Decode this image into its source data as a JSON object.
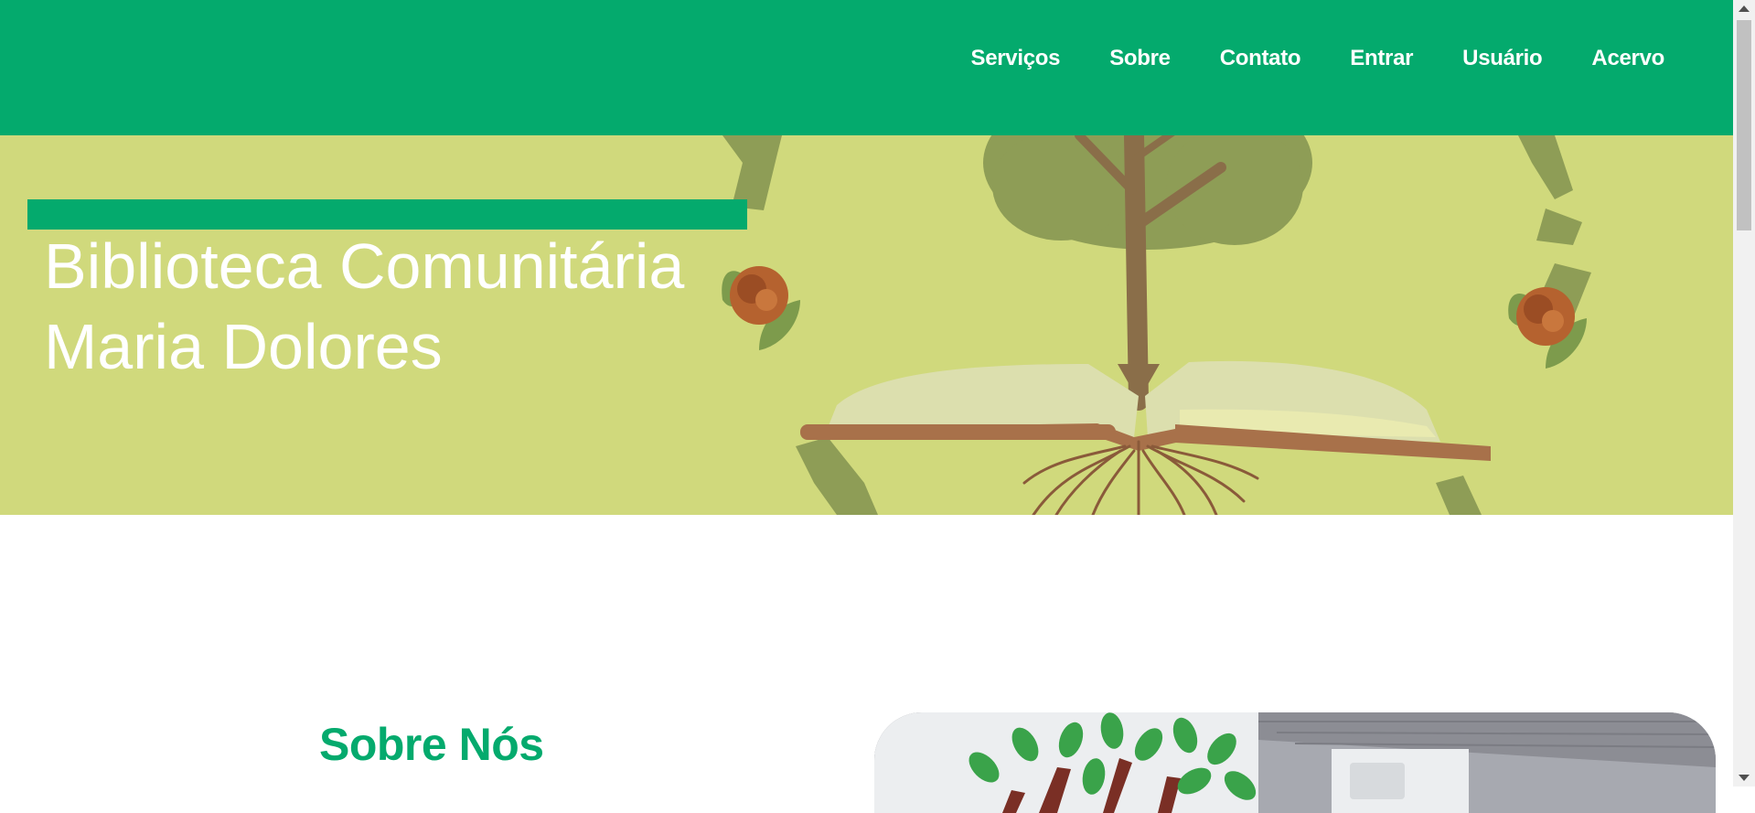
{
  "nav": {
    "links": [
      {
        "label": "Serviços"
      },
      {
        "label": "Sobre"
      },
      {
        "label": "Contato"
      },
      {
        "label": "Entrar"
      },
      {
        "label": "Usuário"
      },
      {
        "label": "Acervo"
      }
    ]
  },
  "hero": {
    "title_line1": "Biblioteca Comunitária",
    "title_line2": "Maria Dolores"
  },
  "about": {
    "heading": "Sobre Nós"
  },
  "colors": {
    "brand_green": "#04aa6d",
    "hero_background": "#d0d97c"
  }
}
